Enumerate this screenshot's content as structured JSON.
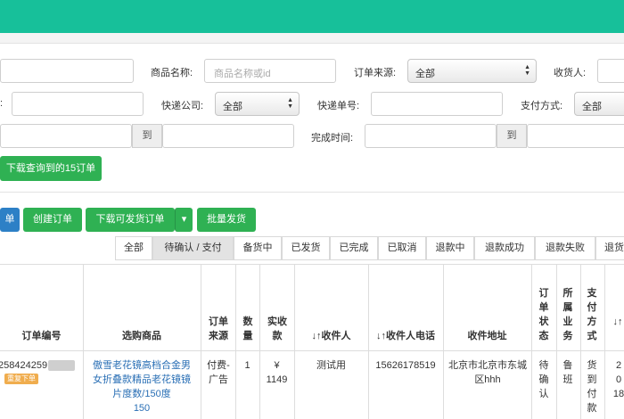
{
  "filters": {
    "product_name_label": "商品名称:",
    "product_name_placeholder": "商品名称或id",
    "order_source_label": "订单来源:",
    "order_source_value": "全部",
    "receiver_label": "收货人:",
    "row2_lead_label": ":",
    "courier_company_label": "快递公司:",
    "courier_company_value": "全部",
    "tracking_no_label": "快递单号:",
    "payment_method_label": "支付方式:",
    "payment_method_value": "全部",
    "to_text": "到",
    "complete_time_label": "完成时间:",
    "to_text_2": "到"
  },
  "buttons": {
    "download_query": "下载查询到的15订单",
    "left_cut": "单",
    "create_order": "创建订单",
    "download_shippable": "下载可发货订单",
    "batch_ship": "批量发货"
  },
  "tabs": [
    "全部",
    "待确认 / 支付",
    "备货中",
    "已发货",
    "已完成",
    "已取消",
    "退款中",
    "退款成功",
    "退款失败",
    "退货"
  ],
  "active_tab_index": 1,
  "table": {
    "headers": {
      "order_no": "订单编号",
      "product": "选购商品",
      "source": "订单来源",
      "qty": "数量",
      "paid": "实收款",
      "receiver": "↓↑收件人",
      "phone": "↓↑收件人电话",
      "address": "收件地址",
      "status": "订单状态",
      "staff": "所属业务",
      "pay_method": "支付方式",
      "last": "↓↑"
    },
    "row": {
      "order_no": "258424259",
      "badge": "重复下单",
      "product": "傲雪老花镜高档合金男女折叠款精品老花镜镜片度数/150度",
      "product_sub": "150",
      "source": "付费-广告",
      "qty": "1",
      "paid_symbol": "¥",
      "paid_amount": "1149",
      "receiver": "测试用",
      "phone": "15626178519",
      "address": "北京市北京市东城区hhh",
      "status": "待确认",
      "staff": "鲁班",
      "pay_method": "货到付款",
      "last_1": "2",
      "last_2": "0",
      "last_3": "18"
    }
  }
}
